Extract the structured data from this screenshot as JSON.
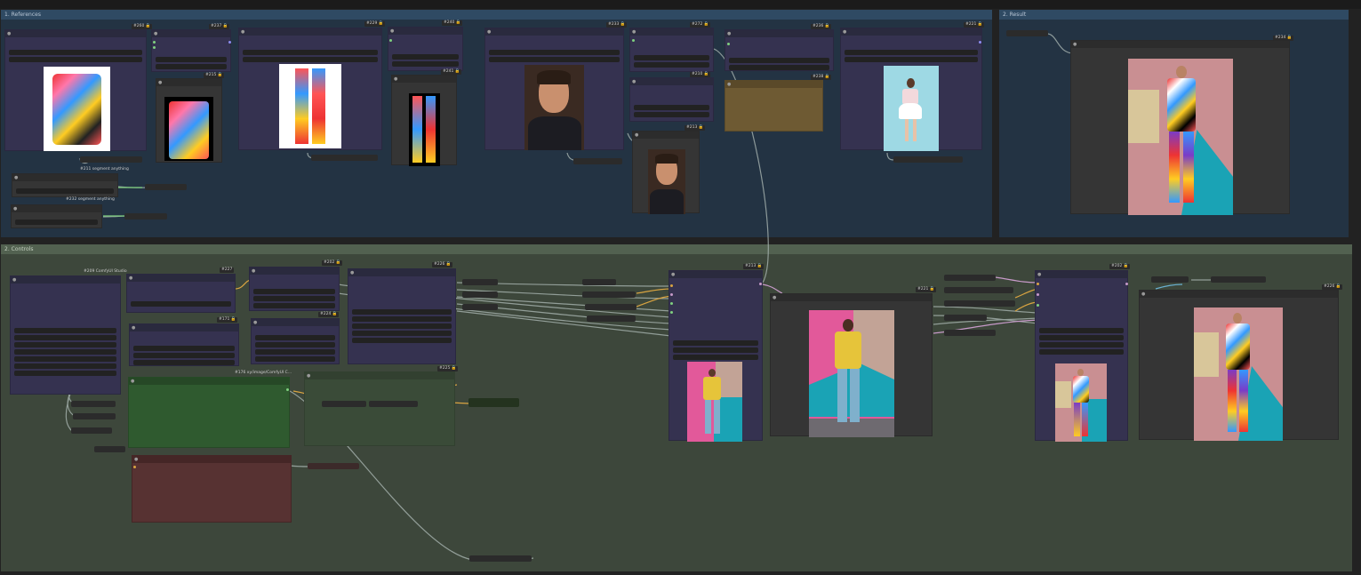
{
  "groups": {
    "references": "1. References",
    "result": "2. Result",
    "controls": "2. Controls"
  },
  "nodes": {
    "seg1": "#211 segment anything",
    "seg2": "#232 segment anything",
    "combo": "#209 ComfyUI Studio",
    "ctl_green": "#176 xy/image/ComfyUI C...",
    "id_s1": "#260 🔒",
    "id_s2": "#237 🔒",
    "id_s3": "#215 🔒",
    "id_s4": "#229 🔒",
    "id_s5": "#240 🔒",
    "id_s6": "#241 🔒",
    "id_s7": "#233 🔒",
    "id_s8": "#272 🔒",
    "id_s9": "#210 🔒",
    "id_c1": "#213 🔒",
    "id_c2": "#236 🔒",
    "id_c3": "#238 🔒",
    "id_c4": "#221 🔒",
    "id_c5": "#234 🔒",
    "id_c6": "#227",
    "id_c7": "#171 🔒",
    "id_c8": "#202 🔒",
    "id_c9": "#224 🔒",
    "id_c10": "#226 🔒",
    "id_c11": "#225 🔒"
  },
  "icons": {
    "lock": "lock-icon",
    "collapse": "collapse-dot-icon"
  },
  "colors": {
    "references_group": "#233343",
    "controls_group": "#3d473b",
    "node_purple": "#353250",
    "node_green": "#2f5a2f",
    "node_red": "#573232",
    "node_olive": "#6e5a33",
    "wire": "#a8b4b0",
    "wire_yellow": "#d9a441",
    "wire_pink": "#c79ac9"
  }
}
